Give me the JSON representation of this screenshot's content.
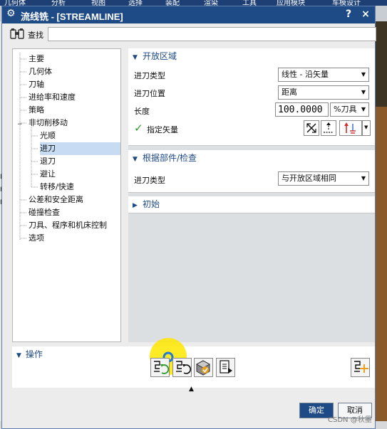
{
  "app_menu": [
    "几何体",
    "分析",
    "视图",
    "选择",
    "装配",
    "渲染",
    "工具",
    "应用模块",
    "车模设计"
  ],
  "side_fragments": [
    "L",
    "K",
    "F"
  ],
  "dialog": {
    "title": "流线铣 - [STREAMLINE]",
    "help_label": "?",
    "close_label": "×"
  },
  "search": {
    "label": "查找",
    "value": "",
    "placeholder": ""
  },
  "tree": {
    "items": [
      {
        "label": "主要",
        "level": 0,
        "selected": false
      },
      {
        "label": "几何体",
        "level": 0,
        "selected": false
      },
      {
        "label": "刀轴",
        "level": 0,
        "selected": false
      },
      {
        "label": "进给率和速度",
        "level": 0,
        "selected": false
      },
      {
        "label": "策略",
        "level": 0,
        "selected": false
      },
      {
        "label": "非切削移动",
        "level": 0,
        "selected": false
      },
      {
        "label": "光顺",
        "level": 1,
        "selected": false
      },
      {
        "label": "进刀",
        "level": 1,
        "selected": true
      },
      {
        "label": "退刀",
        "level": 1,
        "selected": false
      },
      {
        "label": "避让",
        "level": 1,
        "selected": false
      },
      {
        "label": "转移/快速",
        "level": 1,
        "selected": false
      },
      {
        "label": "公差和安全距离",
        "level": 0,
        "selected": false
      },
      {
        "label": "碰撞检查",
        "level": 0,
        "selected": false
      },
      {
        "label": "刀具、程序和机床控制",
        "level": 0,
        "selected": false
      },
      {
        "label": "选项",
        "level": 0,
        "selected": false
      }
    ]
  },
  "open_area": {
    "header": "开放区域",
    "entry_type_label": "进刀类型",
    "entry_type_value": "线性 - 沿矢量",
    "entry_position_label": "进刀位置",
    "entry_position_value": "距离",
    "length_label": "长度",
    "length_value": "100.0000",
    "length_unit": "%刀具",
    "vector_label": "指定矢量"
  },
  "part_check": {
    "header": "根据部件/检查",
    "entry_type_label": "进刀类型",
    "entry_type_value": "与开放区域相同"
  },
  "initial": {
    "header": "初始"
  },
  "operation": {
    "header": "操作"
  },
  "footer": {
    "ok": "确定",
    "cancel": "取消"
  },
  "watermark": "CSDN @秋墨",
  "colors": {
    "title_bar": "#1e4a86",
    "accent_text": "#1e4a86",
    "selected_row": "#c7dcf2",
    "ok_button": "#1e4a86",
    "check_green": "#2a9a2a",
    "highlight": "#ffe600"
  }
}
